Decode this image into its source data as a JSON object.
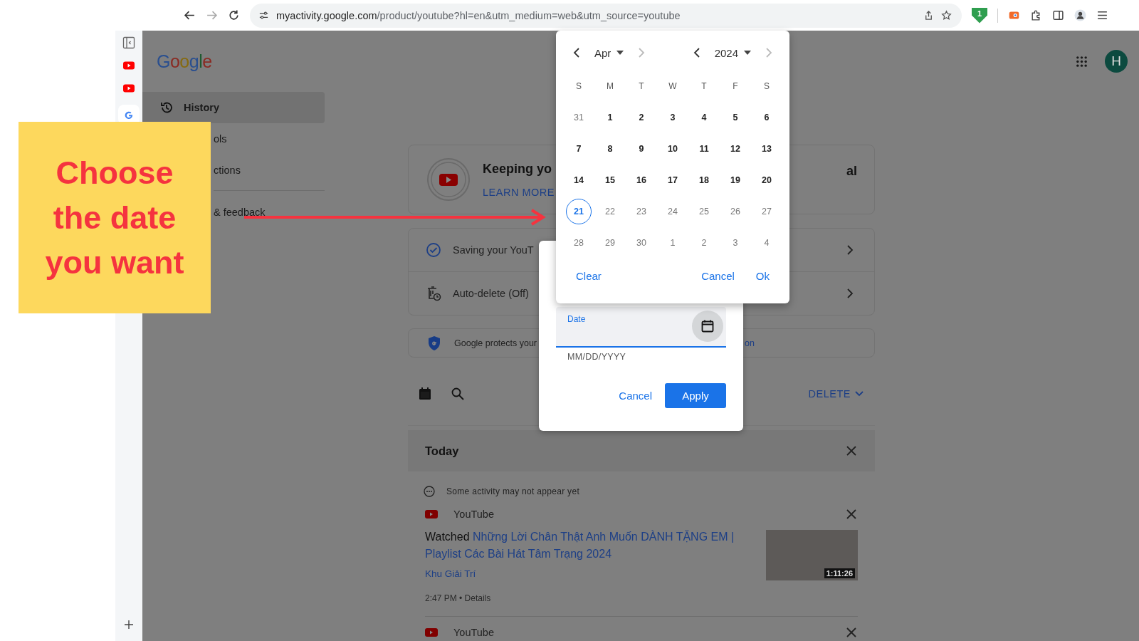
{
  "browser": {
    "url": {
      "host": "myactivity.google.com",
      "path": "/product/youtube?hl=en&utm_medium=web&utm_source=youtube"
    },
    "extension_badge": "1",
    "forward_disabled": true
  },
  "page": {
    "logo": "Google",
    "avatar": "H",
    "nav": [
      {
        "label": "History",
        "selected": true
      },
      {
        "label": "ols",
        "selected": false
      },
      {
        "label": "ctions",
        "selected": false
      },
      {
        "label": "& feedback",
        "selected": false
      }
    ],
    "info_card": {
      "title": "Keeping yo",
      "title_end": "al",
      "link": "LEARN MORE"
    },
    "settings": [
      {
        "label": "Saving your YouT",
        "kind": "check"
      },
      {
        "label": "Auto-delete (Off)",
        "kind": "autodelete"
      }
    ],
    "protect": {
      "text": "Google protects your",
      "link_end": "on"
    },
    "delete_label": "DELETE",
    "today": "Today",
    "notice": "Some activity may not appear yet",
    "entry": {
      "source": "YouTube",
      "verb": "Watched",
      "title": "Những Lời Chân Thật Anh Muốn DÀNH TẶNG EM | Playlist Các Bài Hát Tâm Trạng 2024",
      "channel": "Khu Giải Trí",
      "time": "2:47 PM",
      "separator": "•",
      "details": "Details",
      "duration": "1:11:26"
    },
    "next_source": "YouTube"
  },
  "date_dialog": {
    "label": "Date",
    "hint": "MM/DD/YYYY",
    "cancel": "Cancel",
    "apply": "Apply"
  },
  "calendar": {
    "month": "Apr",
    "year": "2024",
    "next_month_disabled": true,
    "next_year_disabled": true,
    "weekdays": [
      "S",
      "M",
      "T",
      "W",
      "T",
      "F",
      "S"
    ],
    "days": [
      {
        "label": "31",
        "selected": false,
        "disabled": true
      },
      {
        "label": "1",
        "selected": false,
        "disabled": false
      },
      {
        "label": "2",
        "selected": false,
        "disabled": false
      },
      {
        "label": "3",
        "selected": false,
        "disabled": false
      },
      {
        "label": "4",
        "selected": false,
        "disabled": false
      },
      {
        "label": "5",
        "selected": false,
        "disabled": false
      },
      {
        "label": "6",
        "selected": false,
        "disabled": false
      },
      {
        "label": "7",
        "selected": false,
        "disabled": false
      },
      {
        "label": "8",
        "selected": false,
        "disabled": false
      },
      {
        "label": "9",
        "selected": false,
        "disabled": false
      },
      {
        "label": "10",
        "selected": false,
        "disabled": false
      },
      {
        "label": "11",
        "selected": false,
        "disabled": false
      },
      {
        "label": "12",
        "selected": false,
        "disabled": false
      },
      {
        "label": "13",
        "selected": false,
        "disabled": false
      },
      {
        "label": "14",
        "selected": false,
        "disabled": false
      },
      {
        "label": "15",
        "selected": false,
        "disabled": false
      },
      {
        "label": "16",
        "selected": false,
        "disabled": false
      },
      {
        "label": "17",
        "selected": false,
        "disabled": false
      },
      {
        "label": "18",
        "selected": false,
        "disabled": false
      },
      {
        "label": "19",
        "selected": false,
        "disabled": false
      },
      {
        "label": "20",
        "selected": false,
        "disabled": false
      },
      {
        "label": "21",
        "selected": true,
        "disabled": false
      },
      {
        "label": "22",
        "selected": false,
        "disabled": true
      },
      {
        "label": "23",
        "selected": false,
        "disabled": true
      },
      {
        "label": "24",
        "selected": false,
        "disabled": true
      },
      {
        "label": "25",
        "selected": false,
        "disabled": true
      },
      {
        "label": "26",
        "selected": false,
        "disabled": true
      },
      {
        "label": "27",
        "selected": false,
        "disabled": true
      },
      {
        "label": "28",
        "selected": false,
        "disabled": true
      },
      {
        "label": "29",
        "selected": false,
        "disabled": true
      },
      {
        "label": "30",
        "selected": false,
        "disabled": true
      },
      {
        "label": "1",
        "selected": false,
        "disabled": true
      },
      {
        "label": "2",
        "selected": false,
        "disabled": true
      },
      {
        "label": "3",
        "selected": false,
        "disabled": true
      },
      {
        "label": "4",
        "selected": false,
        "disabled": true
      }
    ],
    "clear": "Clear",
    "cancel": "Cancel",
    "ok": "Ok"
  },
  "callout": {
    "lines": [
      "Choose",
      "the date",
      "you want"
    ]
  }
}
